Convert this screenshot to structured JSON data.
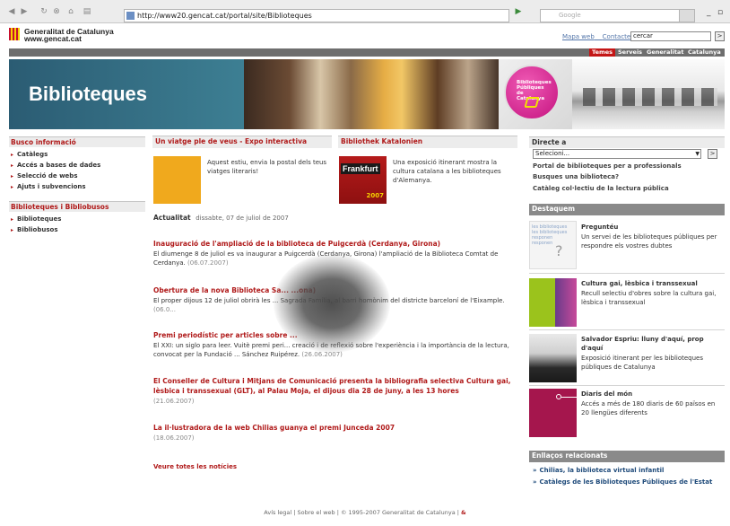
{
  "browser": {
    "url": "http://www20.gencat.cat/portal/site/Biblioteques",
    "search_placeholder": "Google"
  },
  "header": {
    "org_line1": "Generalitat de Catalunya",
    "org_line2": "www.gencat.cat",
    "links": [
      "Mapa web",
      "Contacte"
    ],
    "search_value": "cercar",
    "go": ">",
    "nav": [
      "Temes",
      "Serveis",
      "Generalitat",
      "Catalunya"
    ]
  },
  "banner": {
    "title": "Biblioteques",
    "badge": "Biblioteques Públiques de Catalunya"
  },
  "left": {
    "busco_title": "Busco informació",
    "busco_items": [
      "Catàlegs",
      "Accés a bases de dades",
      "Selecció de webs",
      "Ajuts i subvencions"
    ],
    "bib_title": "Biblioteques i Bibliobusos",
    "bib_items": [
      "Biblioteques",
      "Bibliobusos"
    ]
  },
  "center": {
    "feature1": {
      "title": "Un viatge ple de veus - Expo interactiva",
      "text": "Aquest estiu, envia la postal dels teus viatges literaris!"
    },
    "feature2": {
      "title": "Bibliothek Katalonien",
      "image_label": "Frankfurt",
      "image_year": "2007",
      "text": "Una exposició itinerant mostra la cultura catalana a les biblioteques d'Alemanya."
    },
    "actualitat_label": "Actualitat",
    "actualitat_date": "dissabte, 07 de juliol de 2007",
    "news": [
      {
        "title": "Inauguració de l'ampliació de la biblioteca de Puigcerdà (Cerdanya, Girona)",
        "body": "El diumenge 8 de juliol es va inaugurar a Puigcerdà (Cerdanya, Girona) l'ampliació de la Biblioteca Comtat de Cerdanya.",
        "date": "(06.07.2007)"
      },
      {
        "title": "Obertura de la nova Biblioteca Sa... ...ona)",
        "body": "El proper dijous 12 de juliol obrirà les ... Sagrada Família, al barri homònim del districte barceloní de l'Eixample.",
        "date": "(06.0..."
      },
      {
        "title": "Premi periodístic per articles sobre ...",
        "body": "El XXI: un siglo para leer. Vuitè premi peri... creació i de reflexió sobre l'experiència i la importància de la lectura, convocat per la Fundació ... Sánchez Ruipérez.",
        "date": "(26.06.2007)"
      },
      {
        "title": "El Conseller de Cultura i Mitjans de Comunicació presenta la bibliografia selectiva Cultura gai, lèsbica i transsexual (GLT), al Palau Moja, el dijous dia 28 de juny, a les 13 hores",
        "body": "",
        "date": "(21.06.2007)"
      },
      {
        "title": "La il·lustradora de la web Chilias guanya el premi Junceda 2007",
        "body": "",
        "date": "(18.06.2007)"
      }
    ],
    "more": "Veure totes les notícies"
  },
  "right": {
    "directe_title": "Directe a",
    "select_value": "Selecioni...",
    "go": ">",
    "links": [
      "Portal de biblioteques per a professionals",
      "Busques una biblioteca?",
      "Catàleg col·lectiu de la lectura pública"
    ],
    "destaquem_title": "Destaquem",
    "destaquem": [
      {
        "title": "Preguntéu",
        "text": "Un servei de les biblioteques públiques per respondre els vostres dubtes",
        "img_text": "les biblioteques les biblioteques responen responen"
      },
      {
        "title": "Cultura gai, lèsbica i transsexual",
        "text": "Recull selectiu d'obres sobre la cultura gai, lèsbica i transsexual"
      },
      {
        "title": "Salvador Espriu: lluny d'aquí, prop d'aquí",
        "text": "Exposició itinerant per les biblioteques públiques de Catalunya"
      },
      {
        "title": "Diaris del món",
        "text": "Accés a més de 180 diaris de 60 països en 20 llengües diferents"
      }
    ],
    "enllacos_title": "Enllaços relacionats",
    "enllacos": [
      "Chilias, la biblioteca virtual infantil",
      "Catàlegs de les Biblioteques Públiques de l'Estat"
    ]
  },
  "footer": "Avís legal | Sobre el web | © 1995-2007 Generalitat de Catalunya |",
  "colors": {
    "accent_red": "#b01a1a",
    "banner_teal": "#2f5e74",
    "badge_magenta": "#c4127f"
  }
}
